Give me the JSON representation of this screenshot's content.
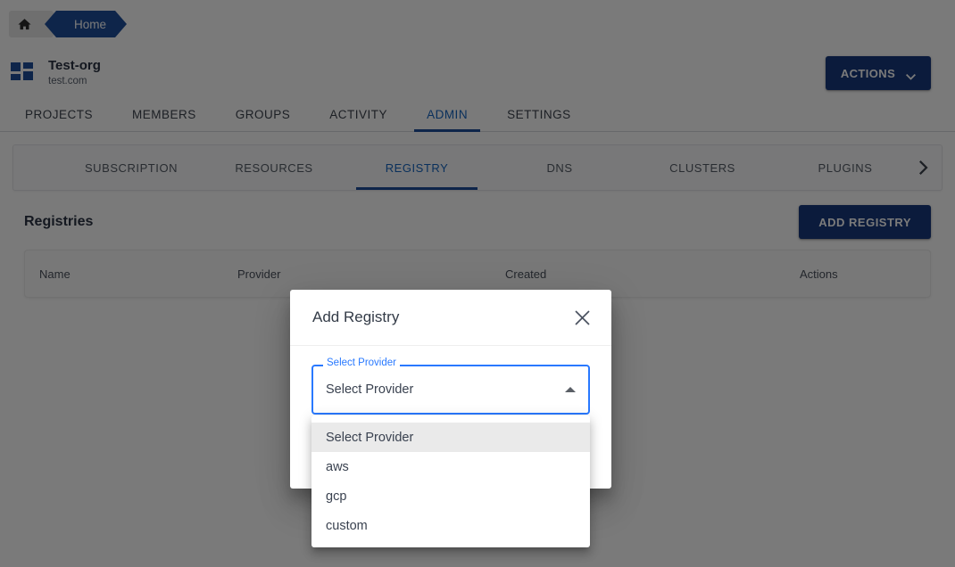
{
  "breadcrumb": {
    "home_icon": "home-icon",
    "items": [
      {
        "label": "Home"
      }
    ]
  },
  "org": {
    "logo_icon": "grid-logo-icon",
    "name": "Test-org",
    "domain": "test.com",
    "actions_label": "ACTIONS",
    "actions_caret_icon": "chevron-down-icon"
  },
  "main_tabs": [
    {
      "label": "PROJECTS",
      "active": false
    },
    {
      "label": "MEMBERS",
      "active": false
    },
    {
      "label": "GROUPS",
      "active": false
    },
    {
      "label": "ACTIVITY",
      "active": false
    },
    {
      "label": "ADMIN",
      "active": true
    },
    {
      "label": "SETTINGS",
      "active": false
    }
  ],
  "sub_tabs": {
    "items": [
      {
        "label": "SUBSCRIPTION",
        "active": false
      },
      {
        "label": "RESOURCES",
        "active": false
      },
      {
        "label": "REGISTRY",
        "active": true
      },
      {
        "label": "DNS",
        "active": false
      },
      {
        "label": "CLUSTERS",
        "active": false
      },
      {
        "label": "PLUGINS",
        "active": false
      }
    ],
    "scroll_next_icon": "chevron-right-icon"
  },
  "registries": {
    "title": "Registries",
    "add_button_label": "ADD REGISTRY",
    "table": {
      "columns": [
        "Name",
        "Provider",
        "Created",
        "Actions"
      ],
      "rows": []
    }
  },
  "modal": {
    "title": "Add Registry",
    "close_icon": "close-icon",
    "provider_field": {
      "label": "Select Provider",
      "value": "Select Provider",
      "caret_icon": "caret-up-icon",
      "open": true,
      "options": [
        {
          "label": "Select Provider",
          "selected": true
        },
        {
          "label": "aws",
          "selected": false
        },
        {
          "label": "gcp",
          "selected": false
        },
        {
          "label": "custom",
          "selected": false
        }
      ]
    }
  },
  "colors": {
    "brand_blue": "#17397d",
    "accent_blue": "#1f4e9c",
    "link_blue": "#1565c0",
    "focus_blue": "#2979ff",
    "scrim": "#7b7c7e"
  }
}
